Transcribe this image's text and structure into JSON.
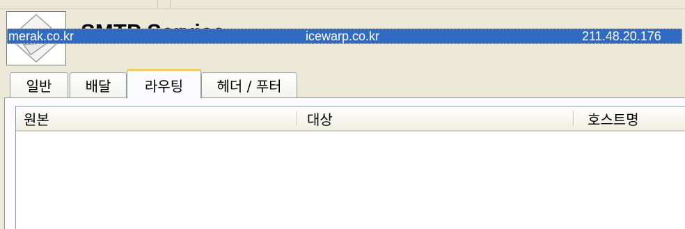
{
  "header": {
    "title": "SMTP Service",
    "icon": "envelope-icon"
  },
  "tabs": [
    {
      "label": "일반",
      "active": false
    },
    {
      "label": "배달",
      "active": false
    },
    {
      "label": "라우팅",
      "active": true
    },
    {
      "label": "헤더 / 푸터",
      "active": false
    }
  ],
  "routing_table": {
    "columns": [
      "원본",
      "대상",
      "호스트명"
    ],
    "rows": [
      {
        "source": "merak.co.kr",
        "target": "icewarp.co.kr",
        "host": "211.48.20.176",
        "selected": true
      }
    ]
  },
  "colors": {
    "window_bg": "#ece9d8",
    "selection": "#316ac5",
    "active_tab_accent": "#ffc83c"
  }
}
